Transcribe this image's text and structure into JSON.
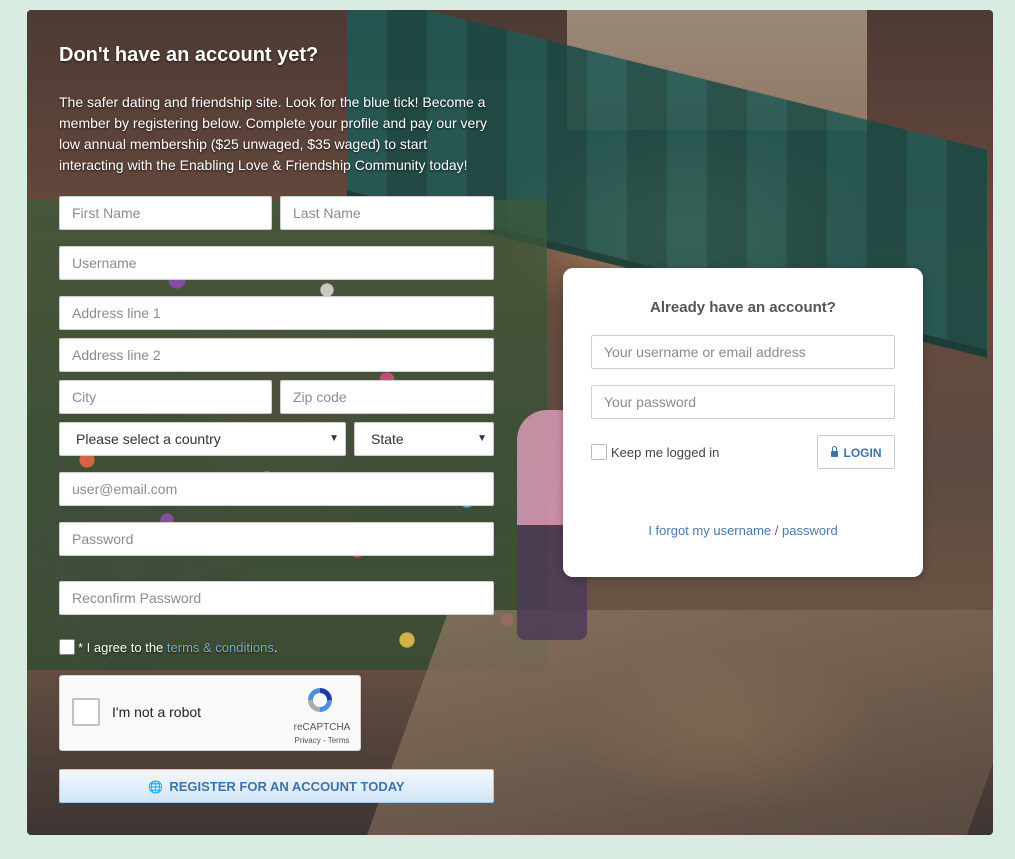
{
  "register": {
    "title": "Don't have an account yet?",
    "description": "The safer dating and friendship site. Look for the blue tick! Become a member by registering below. Complete your profile and pay our very low annual membership ($25 unwaged, $35 waged) to start interacting with the Enabling Love & Friendship Community today!",
    "first_name_placeholder": "First Name",
    "last_name_placeholder": "Last Name",
    "username_placeholder": "Username",
    "address1_placeholder": "Address line 1",
    "address2_placeholder": "Address line 2",
    "city_placeholder": "City",
    "zip_placeholder": "Zip code",
    "country_select": "Please select a country",
    "state_select": "State",
    "email_placeholder": "user@email.com",
    "password_placeholder": "Password",
    "reconfirm_placeholder": "Reconfirm Password",
    "agree_prefix": "* I agree to the ",
    "agree_link": "terms & conditions",
    "agree_suffix": ".",
    "submit_label": "REGISTER FOR AN ACCOUNT TODAY",
    "submit_icon": "globe-icon"
  },
  "captcha": {
    "label": "I'm not a robot",
    "brand": "reCAPTCHA",
    "links": "Privacy - Terms"
  },
  "login": {
    "title": "Already have an account?",
    "username_placeholder": "Your username or email address",
    "password_placeholder": "Your password",
    "keep_logged_in": "Keep me logged in",
    "login_label": "LOGIN",
    "login_icon": "lock-icon",
    "forgot_username": "I forgot my username",
    "forgot_sep": "/",
    "forgot_password": "password"
  },
  "colors": {
    "page_bg": "#d9ece2",
    "link": "#4e78a8",
    "button_text": "#3f73a6"
  }
}
